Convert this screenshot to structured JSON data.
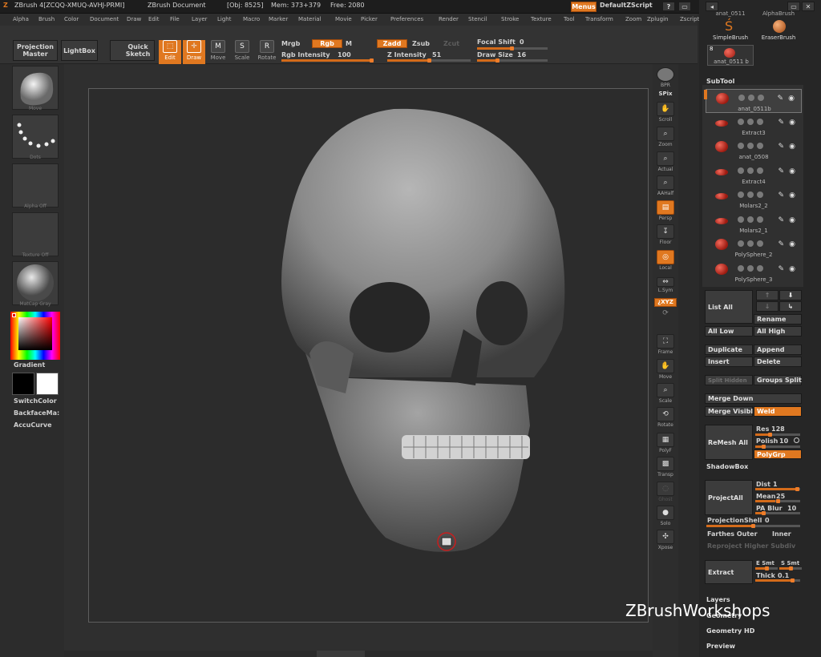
{
  "titlebar": {
    "app": "ZBrush 4[ZCQQ-XMUQ-AVHJ-PRMI]",
    "doc": "ZBrush Document",
    "obj": "[Obj: 8525]",
    "mem": "Mem: 373+379",
    "free": "Free: 2080",
    "menus": "Menus",
    "script": "DefaultZScript"
  },
  "menubar": [
    "Alpha",
    "Brush",
    "Color",
    "Document",
    "Draw",
    "Edit",
    "File",
    "Layer",
    "Light",
    "Macro",
    "Marker",
    "Material",
    "Movie",
    "Picker",
    "Preferences",
    "Render",
    "Stencil",
    "Stroke",
    "Texture",
    "Tool",
    "Transform",
    "Zoom",
    "Zplugin",
    "Zscript"
  ],
  "shelf": {
    "projection_master": "Projection Master",
    "lightbox": "LightBox",
    "quick_sketch": "Quick Sketch",
    "edit": "Edit",
    "draw": "Draw",
    "move": "Move",
    "scale": "Scale",
    "rotate": "Rotate",
    "mrgb": "Mrgb",
    "rgb": "Rgb",
    "m": "M",
    "zadd": "Zadd",
    "zsub": "Zsub",
    "zcut": "Zcut",
    "rgb_intensity_label": "Rgb Intensity",
    "rgb_intensity": "100",
    "z_intensity_label": "Z Intensity",
    "z_intensity": "51",
    "focal_shift_label": "Focal Shift",
    "focal_shift": "0",
    "draw_size_label": "Draw Size",
    "draw_size": "16",
    "levels": {
      "rgb_intensity": 1.0,
      "z_intensity": 0.51,
      "focal_shift": 0.5,
      "draw_size": 0.3
    }
  },
  "leftpanel": {
    "brush_cap": "Move",
    "stroke_cap": "Dots",
    "alpha_cap": "Alpha Off",
    "texture_cap": "Texture Off",
    "material_cap": "MatCap Gray",
    "gradient": "Gradient",
    "switchcolor": "SwitchColor",
    "backface": "BackfaceMa:",
    "accucurve": "AccuCurve"
  },
  "rightstrip": {
    "bpr": "BPR",
    "spix": "SPix",
    "scroll": "Scroll",
    "zoom": "Zoom",
    "actual": "Actual",
    "aahalf": "AAHalf",
    "persp": "Persp",
    "floor": "Floor",
    "local": "Local",
    "lsym": "L.Sym",
    "xyz": "¿XYZ",
    "frame": "Frame",
    "move": "Move",
    "scale": "Scale",
    "rotate": "Rotate",
    "polyf": "PolyF",
    "transp": "Transp",
    "ghost": "Ghost",
    "solo": "Solo",
    "xpose": "Xpose"
  },
  "rightpanel": {
    "top_labels": {
      "anat": "anat_0511",
      "alphabrush": "AlphaBrush",
      "simplebrush": "SimpleBrush",
      "eraserbrush": "EraserBrush",
      "count": "8",
      "anat_b": "anat_0511 b"
    },
    "subtool_header": "SubTool",
    "subtools": [
      {
        "name": "anat_0511b",
        "selected": true
      },
      {
        "name": "Extract3",
        "selected": false
      },
      {
        "name": "anat_0508",
        "selected": false
      },
      {
        "name": "Extract4",
        "selected": false
      },
      {
        "name": "Molars2_2",
        "selected": false
      },
      {
        "name": "Molars2_1",
        "selected": false
      },
      {
        "name": "PolySphere_2",
        "selected": false
      },
      {
        "name": "PolySphere_3",
        "selected": false
      }
    ],
    "list_all": "List All",
    "rename": "Rename",
    "all_low": "All Low",
    "all_high": "All High",
    "duplicate": "Duplicate",
    "append": "Append",
    "insert": "Insert",
    "delete": "Delete",
    "split_hidden": "Split Hidden",
    "groups_split": "Groups Split",
    "merge_down": "Merge Down",
    "merge_visible": "Merge Visibl",
    "weld": "Weld",
    "remesh_all": "ReMesh All",
    "res_label": "Res",
    "res": "128",
    "polish_label": "Polish",
    "polish": "10",
    "polygrp": "PolyGrp",
    "shadowbox": "ShadowBox",
    "projectall": "ProjectAll",
    "dist_label": "Dist",
    "dist": "1",
    "mean_label": "Mean",
    "mean": "25",
    "pablur_label": "PA Blur",
    "pablur": "10",
    "projectionshell_label": "ProjectionShell",
    "projectionshell": "0",
    "farthest": "Farthes Outer",
    "inner": "Inner",
    "reproject": "Reproject Higher Subdiv",
    "extract": "Extract",
    "esmt": "E Smt",
    "ssmt": "S Smt",
    "thick_label": "Thick",
    "thick": "0.1",
    "layers": "Layers",
    "geometry": "Geometry",
    "geometry_hd": "Geometry HD",
    "preview": "Preview"
  },
  "watermark": "ZBrushWorkshops",
  "colors": {
    "accent": "#e07820",
    "panel": "#303030",
    "background": "#2a2a2a"
  }
}
